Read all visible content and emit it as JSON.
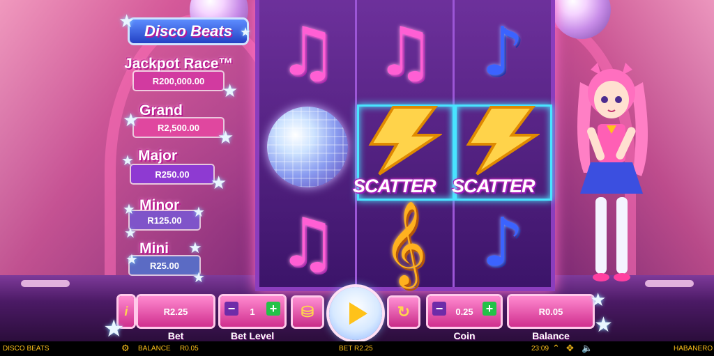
{
  "game": {
    "logo": "Disco Beats"
  },
  "jackpots": [
    {
      "name": "Jackpot Race™",
      "amount": "R200,000.00",
      "color": "#d23aa0"
    },
    {
      "name": "Grand",
      "amount": "R2,500.00",
      "color": "#e0479f"
    },
    {
      "name": "Major",
      "amount": "R250.00",
      "color": "#8e3ad2"
    },
    {
      "name": "Minor",
      "amount": "R125.00",
      "color": "#7f54c9"
    },
    {
      "name": "Mini",
      "amount": "R25.00",
      "color": "#5b6bc4"
    }
  ],
  "reels": {
    "symbols": [
      [
        "pink-note",
        "disco-ball",
        "pink-note"
      ],
      [
        "pink-note",
        "scatter",
        "treble-clef"
      ],
      [
        "blue-note",
        "scatter",
        "blue-note"
      ]
    ],
    "scatter_label": "SCATTER"
  },
  "controls": {
    "info_label": "i",
    "bet_value": "R2.25",
    "bet_label": "Bet",
    "bet_level_value": "1",
    "bet_level_label": "Bet Level",
    "coin_value": "0.25",
    "coin_label": "Coin",
    "balance_value": "R0.05",
    "balance_label": "Balance",
    "minus": "−",
    "plus": "+"
  },
  "statusbar": {
    "game_name": "DISCO BEATS",
    "balance_label": "BALANCE",
    "balance_value": "R0.05",
    "bet_text": "BET R2.25",
    "time": "23:09",
    "provider": "HABANERO"
  },
  "colors": {
    "accent_pink": "#ff5fd4",
    "accent_blue": "#3b63ff",
    "status_gold": "#ffc21a",
    "plus_green": "#23c248"
  }
}
